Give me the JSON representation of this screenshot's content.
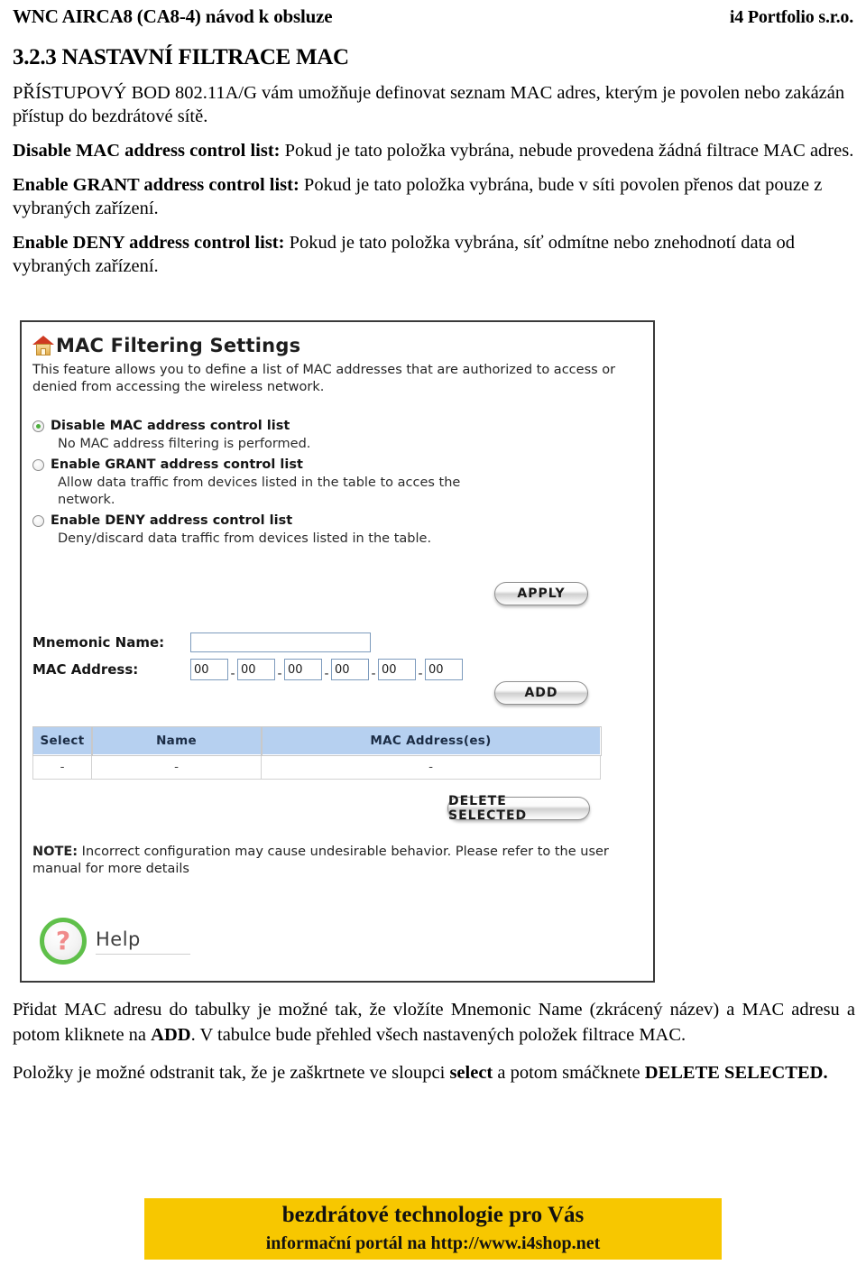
{
  "header": {
    "left": "WNC AIRCA8 (CA8-4) návod k obsluze",
    "right": "i4 Portfolio s.r.o."
  },
  "section": {
    "title": "3.2.3 NASTAVNÍ FILTRACE MAC",
    "intro": "PŘÍSTUPOVÝ BOD 802.11A/G vám umožňuje definovat seznam MAC adres, kterým je povolen nebo zakázán přístup do bezdrátové sítě.",
    "paragraphs": [
      {
        "lead": "Disable MAC address control list:",
        "rest": " Pokud je tato položka vybrána, nebude provedena žádná filtrace MAC adres."
      },
      {
        "lead": "Enable GRANT address control list:",
        "rest": " Pokud je tato položka vybrána, bude v síti povolen přenos dat pouze z vybraných zařízení."
      },
      {
        "lead": "Enable DENY address control list:",
        "rest": " Pokud je tato položka vybrána, síť odmítne nebo znehodnotí data od vybraných zařízení."
      }
    ]
  },
  "screenshot": {
    "panel_title": "MAC Filtering Settings",
    "panel_icon": "house-icon",
    "panel_description": "This feature allows you to define a list of MAC addresses that are authorized to access or denied from accessing the wireless network.",
    "options": [
      {
        "label": "Disable MAC address control list",
        "help": "No MAC address filtering is performed.",
        "selected": true
      },
      {
        "label": "Enable GRANT address control list",
        "help": "Allow data traffic from devices listed in the table to acces the network.",
        "selected": false
      },
      {
        "label": "Enable DENY address control list",
        "help": "Deny/discard data traffic from devices listed in the table.",
        "selected": false
      }
    ],
    "apply_button": "APPLY",
    "add_button": "ADD",
    "delete_button": "DELETE SELECTED",
    "fields": {
      "mnemonic_label": "Mnemonic Name:",
      "mnemonic_value": "",
      "mac_label": "MAC Address:",
      "mac_octets": [
        "00",
        "00",
        "00",
        "00",
        "00",
        "00"
      ],
      "mac_separator": "-"
    },
    "table": {
      "columns": [
        "Select",
        "Name",
        "MAC Address(es)"
      ],
      "rows": [
        [
          "-",
          "-",
          "-"
        ]
      ]
    },
    "note_lead": "NOTE:",
    "note_rest": " Incorrect configuration may cause undesirable behavior. Please refer to the user manual for more details",
    "help_label": "Help",
    "help_icon_glyph": "?"
  },
  "closing": {
    "p1_a": "Přidat MAC adresu do tabulky je možné tak, že vložíte Mnemonic Name (zkrácený název) a MAC adresu a potom kliknete na ",
    "p1_b": "ADD",
    "p1_c": ". V tabulce bude přehled všech nastavených položek filtrace MAC.",
    "p2_a": "Položky je možné odstranit tak, že je zaškrtnete ve sloupci ",
    "p2_b": "select",
    "p2_c": " a potom smáčknete ",
    "p2_d": "DELETE SELECTED."
  },
  "footer": {
    "line1": "bezdrátové technologie pro Vás",
    "line2": "informační portál na http://www.i4shop.net",
    "background": "#f7c700"
  }
}
